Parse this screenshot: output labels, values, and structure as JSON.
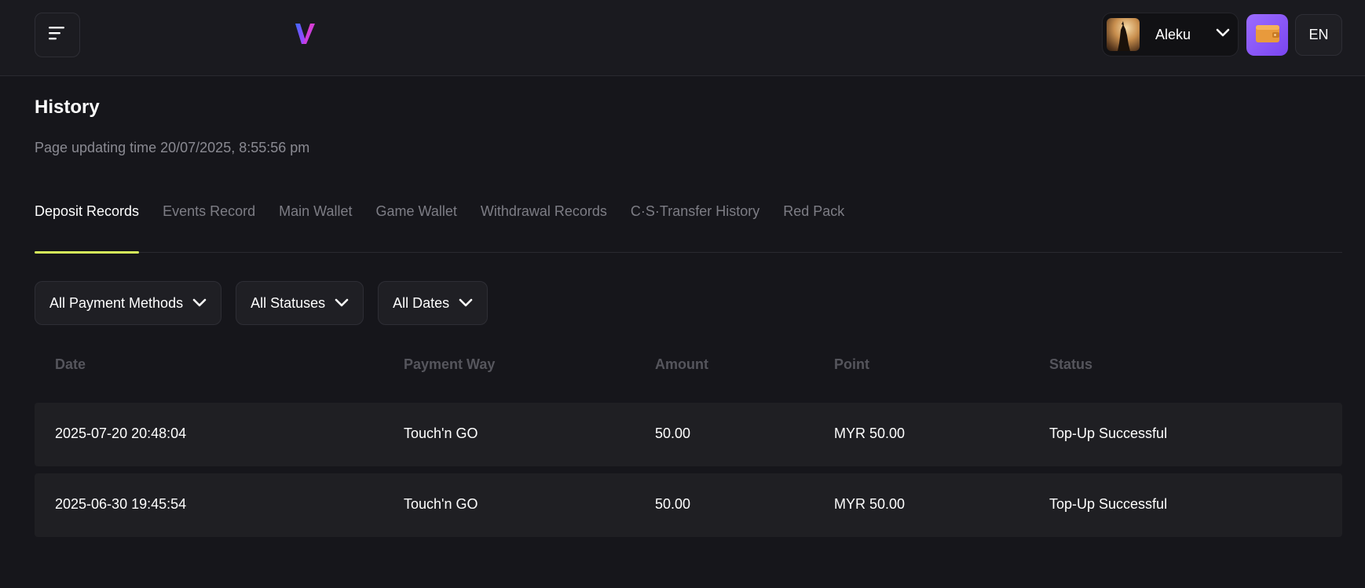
{
  "header": {
    "user_name": "Aleku",
    "language": "EN"
  },
  "page": {
    "title": "History",
    "update_time": "Page updating time 20/07/2025, 8:55:56 pm"
  },
  "tabs": [
    {
      "label": "Deposit Records",
      "active": true
    },
    {
      "label": "Events Record",
      "active": false
    },
    {
      "label": "Main Wallet",
      "active": false
    },
    {
      "label": "Game Wallet",
      "active": false
    },
    {
      "label": "Withdrawal Records",
      "active": false
    },
    {
      "label": "C·S·Transfer History",
      "active": false
    },
    {
      "label": "Red Pack",
      "active": false
    }
  ],
  "filters": {
    "payment_methods": "All Payment Methods",
    "statuses": "All Statuses",
    "dates": "All Dates"
  },
  "table": {
    "headers": {
      "date": "Date",
      "payment_way": "Payment Way",
      "amount": "Amount",
      "point": "Point",
      "status": "Status"
    },
    "rows": [
      {
        "date": "2025-07-20 20:48:04",
        "payment_way": "Touch'n GO",
        "amount": "50.00",
        "point": "MYR 50.00",
        "status": "Top-Up Successful"
      },
      {
        "date": "2025-06-30 19:45:54",
        "payment_way": "Touch'n GO",
        "amount": "50.00",
        "point": "MYR 50.00",
        "status": "Top-Up Successful"
      }
    ]
  },
  "colors": {
    "accent_tab_underline": "#d6f05a",
    "wallet_button": "#8b5cf6",
    "background": "#16161b"
  },
  "icons": {
    "menu": "menu-lines-icon",
    "logo": "v-logo-icon",
    "chevron": "chevron-down-icon",
    "wallet": "wallet-icon"
  }
}
